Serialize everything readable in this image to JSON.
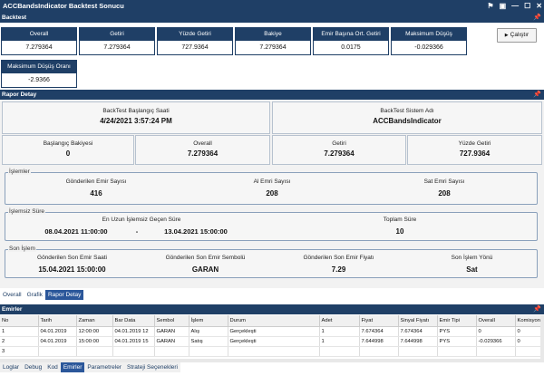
{
  "window": {
    "title": "ACCBandsIndicator Backtest Sonucu"
  },
  "backtest": {
    "header": "Backtest",
    "run_label": "Çalıştır",
    "metrics": [
      {
        "label": "Overall",
        "value": "7.279364"
      },
      {
        "label": "Getiri",
        "value": "7.279364"
      },
      {
        "label": "Yüzde Getiri",
        "value": "727.9364"
      },
      {
        "label": "Bakiye",
        "value": "7.279364"
      },
      {
        "label": "Emir Başına Ort. Getiri",
        "value": "0.0175"
      },
      {
        "label": "Maksimum Düşüş",
        "value": "-0.029366"
      },
      {
        "label": "Maksimum Düşüş Oranı",
        "value": "-2.9366"
      }
    ]
  },
  "rapor": {
    "header": "Rapor Detay",
    "start_time_label": "BackTest Başlangıç Saati",
    "start_time_value": "4/24/2021 3:57:24 PM",
    "system_label": "BackTest Sistem Adı",
    "system_value": "ACCBandsIndicator",
    "summary": [
      {
        "label": "Başlangıç Bakiyesi",
        "value": "0"
      },
      {
        "label": "Overall",
        "value": "7.279364"
      },
      {
        "label": "Getiri",
        "value": "7.279364"
      },
      {
        "label": "Yüzde Getiri",
        "value": "727.9364"
      }
    ],
    "islemler": {
      "title": "İşlemler",
      "items": [
        {
          "label": "Gönderilen Emir Sayısı",
          "value": "416"
        },
        {
          "label": "Al Emri Sayısı",
          "value": "208"
        },
        {
          "label": "Sat Emri Sayısı",
          "value": "208"
        }
      ]
    },
    "islemsiz": {
      "title": "İşlemsiz Süre",
      "longest_label": "En Uzun İşlemsiz Geçen Süre",
      "from": "08.04.2021 11:00:00",
      "sep": "-",
      "to": "13.04.2021 15:00:00",
      "total_label": "Toplam Süre",
      "total_value": "10"
    },
    "son_islem": {
      "title": "Son İşlem",
      "items": [
        {
          "label": "Gönderilen Son Emir Saati",
          "value": "15.04.2021 15:00:00"
        },
        {
          "label": "Gönderilen Son Emir Sembolü",
          "value": "GARAN"
        },
        {
          "label": "Gönderilen Son Emir Fiyatı",
          "value": "7.29"
        },
        {
          "label": "Son İşlem Yönü",
          "value": "Sat"
        }
      ]
    }
  },
  "top_tabs": [
    "Overall",
    "Grafik",
    "Rapor Detay"
  ],
  "emirler": {
    "header": "Emirler",
    "columns": [
      "No",
      "Tarih",
      "Zaman",
      "Bar Data",
      "Sembol",
      "İşlem",
      "Durum",
      "Adet",
      "Fiyat",
      "Sinyal Fiyatı",
      "Emir Tipi",
      "Overall",
      "Komisyon"
    ],
    "rows": [
      [
        "1",
        "04.01.2019",
        "12:00:00",
        "04.01.2019 12",
        "GARAN",
        "Alış",
        "Gerçekleşti",
        "1",
        "7.674364",
        "7.674364",
        "PYS",
        "0",
        "0"
      ],
      [
        "2",
        "04.01.2019",
        "15:00:00",
        "04.01.2019 15",
        "GARAN",
        "Satış",
        "Gerçekleşti",
        "1",
        "7.644998",
        "7.644998",
        "PYS",
        "-0.029366",
        "0"
      ],
      [
        "3",
        "",
        "",
        "",
        "",
        "",
        "",
        "",
        "",
        "",
        "",
        "",
        ""
      ]
    ]
  },
  "bottom_tabs": [
    "Loglar",
    "Debug",
    "Kod",
    "Emirler",
    "Parametreler",
    "Strateji Seçenekleri"
  ]
}
